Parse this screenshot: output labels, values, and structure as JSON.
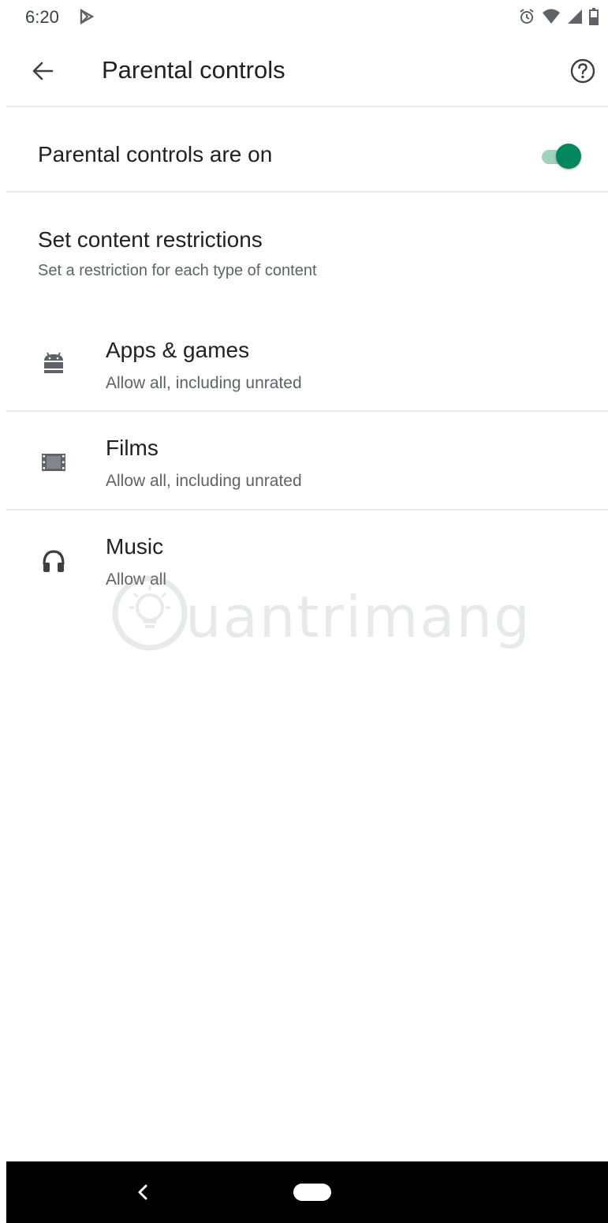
{
  "status_bar": {
    "time": "6:20",
    "left_icon": "play-store-notification-icon",
    "right_icons": [
      "alarm-icon",
      "wifi-icon",
      "signal-icon",
      "battery-icon"
    ]
  },
  "header": {
    "title": "Parental controls",
    "back_icon": "back-arrow-icon",
    "help_icon": "help-icon"
  },
  "parental_toggle": {
    "label": "Parental controls are on",
    "state": "on",
    "accent_color": "#01875f"
  },
  "content_restrictions": {
    "title": "Set content restrictions",
    "subtitle": "Set a restriction for each type of content",
    "items": [
      {
        "icon": "android-icon",
        "title": "Apps & games",
        "value": "Allow all, including unrated"
      },
      {
        "icon": "film-icon",
        "title": "Films",
        "value": "Allow all, including unrated"
      },
      {
        "icon": "headphones-icon",
        "title": "Music",
        "value": "Allow all"
      }
    ]
  },
  "watermark": {
    "text": "uantrimang"
  },
  "nav_bar": {
    "back_icon": "nav-back-icon",
    "home_icon": "nav-home-pill-icon"
  }
}
